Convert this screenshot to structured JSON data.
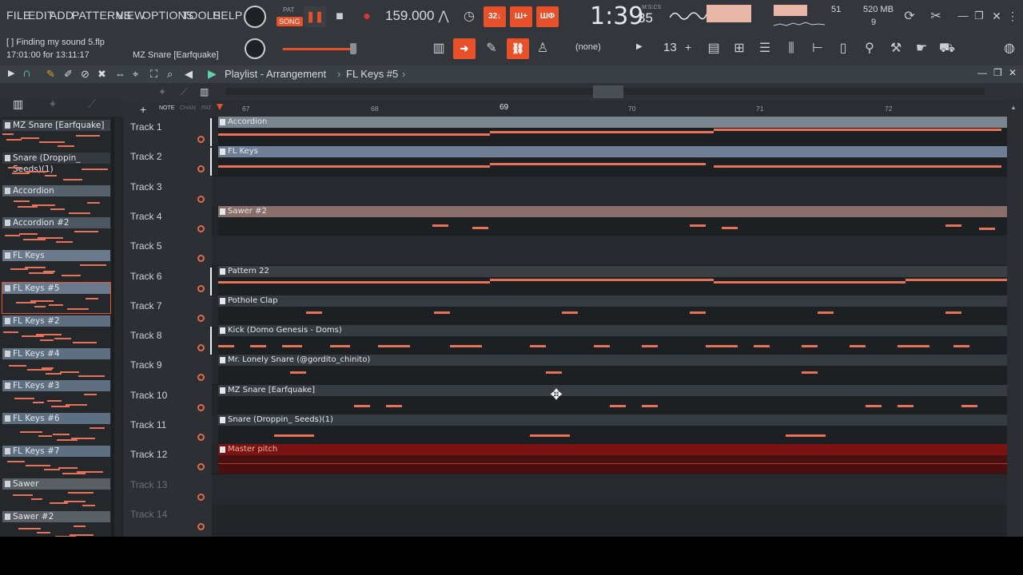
{
  "menu": [
    "FILE",
    "EDIT",
    "ADD",
    "PATTERNS",
    "VIEW",
    "OPTIONS",
    "TOOLS",
    "HELP"
  ],
  "transport": {
    "pat_label": "PAT",
    "song_label": "SONG",
    "tempo": "159.000"
  },
  "time": {
    "main": "1:39",
    "sub": "35",
    "label": "M:S:CS"
  },
  "status": {
    "memory": "520 MB",
    "cpu": "51",
    "polyphony": "9"
  },
  "hint": {
    "line1": "[ ] Finding my sound 5.flp",
    "line2": "17:01:00 for 13:11:17",
    "current": "MZ Snare [Earfquake]"
  },
  "tb2": {
    "snap": "(none)",
    "pattern_num": "13"
  },
  "toolbar_icons": {
    "b1": "32↓",
    "b2": "Ш+",
    "b3": "ШΦ"
  },
  "playlist": {
    "title": "Playlist - Arrangement",
    "pattern": "FL Keys #5",
    "arrow": "›"
  },
  "picker_tabs": {
    "note": "NOTE",
    "chan": "CHAN",
    "pat": "PAT"
  },
  "ruler": [
    "67",
    "68",
    "69",
    "70",
    "71",
    "72"
  ],
  "picker": [
    {
      "name": "MZ Snare [Earfquake]"
    },
    {
      "name": "Snare (Droppin_ Seeds)(1)"
    },
    {
      "name": "Accordion"
    },
    {
      "name": "Accordion #2"
    },
    {
      "name": "FL Keys"
    },
    {
      "name": "FL Keys #5"
    },
    {
      "name": "FL Keys #2"
    },
    {
      "name": "FL Keys #4"
    },
    {
      "name": "FL Keys #3"
    },
    {
      "name": "FL Keys #6"
    },
    {
      "name": "FL Keys #7"
    },
    {
      "name": "Sawer"
    },
    {
      "name": "Sawer #2"
    }
  ],
  "tracks": [
    {
      "label": "Track 1",
      "clip": "Accordion"
    },
    {
      "label": "Track 2",
      "clip": "FL Keys"
    },
    {
      "label": "Track 3",
      "clip": ""
    },
    {
      "label": "Track 4",
      "clip": "Sawer #2"
    },
    {
      "label": "Track 5",
      "clip": ""
    },
    {
      "label": "Track 6",
      "clip": "Pattern 22"
    },
    {
      "label": "Track 7",
      "clip": "Pothole Clap"
    },
    {
      "label": "Track 8",
      "clip": "Kick (Domo Genesis - Doms)"
    },
    {
      "label": "Track 9",
      "clip": "Mr. Lonely Snare (@gordito_chinito)"
    },
    {
      "label": "Track 10",
      "clip": "MZ Snare [Earfquake]"
    },
    {
      "label": "Track 11",
      "clip": "Snare (Droppin_ Seeds)(1)"
    },
    {
      "label": "Track 12",
      "clip": "Master pitch"
    },
    {
      "label": "Track 13",
      "clip": ""
    },
    {
      "label": "Track 14",
      "clip": ""
    }
  ],
  "colors": {
    "accent": "#e8502a",
    "note": "#e8715a",
    "automation": "#7a1414"
  }
}
